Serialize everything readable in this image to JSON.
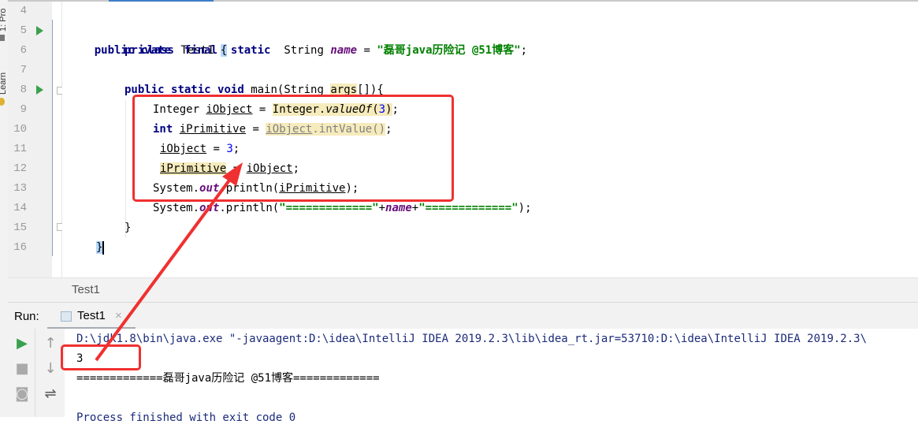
{
  "side_strip": {
    "labels": [
      "1: Pro",
      "Learn"
    ]
  },
  "editor": {
    "lines": [
      {
        "num": "4",
        "text": ""
      },
      {
        "num": "5",
        "text": "public class Test1 {"
      },
      {
        "num": "6",
        "text": "private  final  static  String name = \"磊哥java历险记 @51博客\";"
      },
      {
        "num": "7",
        "text": ""
      },
      {
        "num": "8",
        "text": "public static void main(String args[]){"
      },
      {
        "num": "9",
        "text": "Integer iObject = Integer.valueOf(3);"
      },
      {
        "num": "10",
        "text": "int iPrimitive = iObject.intValue();"
      },
      {
        "num": "11",
        "text": "iObject = 3;"
      },
      {
        "num": "12",
        "text": "iPrimitive = iObject;"
      },
      {
        "num": "13",
        "text": "System.out.println(iPrimitive);"
      },
      {
        "num": "14",
        "text": "System.out.println(\"=============\"+name+\"=============\");"
      },
      {
        "num": "15",
        "text": "}"
      },
      {
        "num": "16",
        "text": "}"
      }
    ],
    "tokens": {
      "public": "public",
      "class": "class",
      "classname": "Test1",
      "lbrace": "{",
      "rbrace": "}",
      "private": "private",
      "final": "final",
      "static": "static",
      "String": "String",
      "name": "name",
      "eq": "=",
      "string_literal": "\"磊哥java历险记 @51博客\"",
      "semi": ";",
      "void": "void",
      "main": "main(String ",
      "args": "args",
      "main_end": "[]){",
      "Integer": "Integer",
      "iObject": "iObject",
      "Integer_dot": "Integer.",
      "valueOf": "valueOf",
      "lparen": "(",
      "three": "3",
      "rparen_semi": ");",
      "int": "int",
      "iPrimitive": "iPrimitive",
      "intValue": ".intValue()",
      "System": "System.",
      "out": "out",
      "println": ".println(",
      "eqs_str": "\"=============\"",
      "plus": "+"
    }
  },
  "breadcrumb": {
    "text": "Test1"
  },
  "run_panel": {
    "label": "Run:",
    "tab_label": "Test1",
    "close": "×",
    "console_lines": [
      "D:\\jdk1.8\\bin\\java.exe \"-javaagent:D:\\idea\\IntelliJ IDEA 2019.2.3\\lib\\idea_rt.jar=53710:D:\\idea\\IntelliJ IDEA 2019.2.3\\",
      "3",
      "=============磊哥java历险记 @51博客=============",
      "",
      "Process finished with exit code 0"
    ]
  },
  "annotation": {
    "color": "#f03030"
  }
}
